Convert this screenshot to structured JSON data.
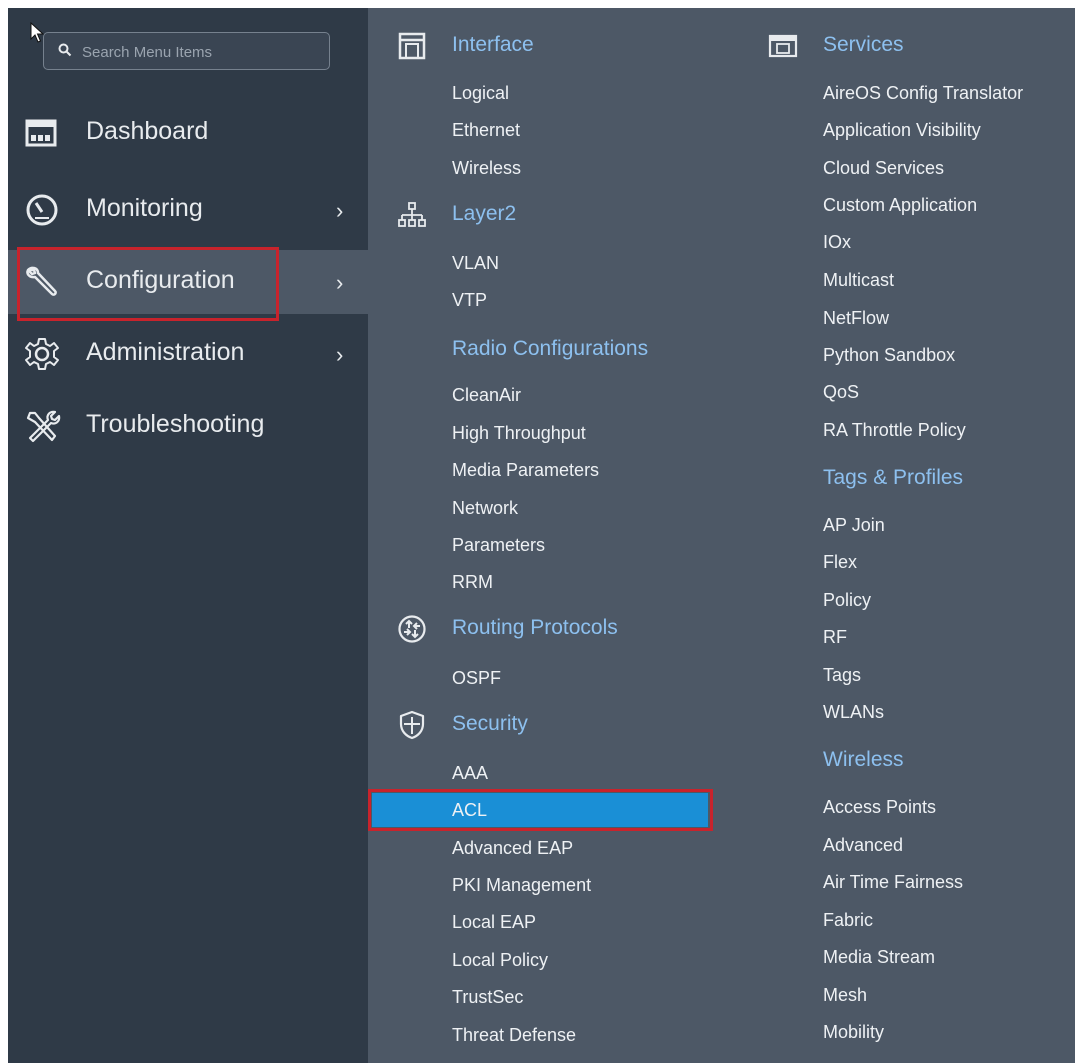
{
  "search": {
    "placeholder": "Search Menu Items"
  },
  "sidebar": {
    "items": [
      {
        "label": "Dashboard",
        "icon": "dashboard-icon"
      },
      {
        "label": "Monitoring",
        "icon": "gauge-icon",
        "chevron": "›"
      },
      {
        "label": "Configuration",
        "icon": "wrench-icon",
        "chevron": "›",
        "active": true
      },
      {
        "label": "Administration",
        "icon": "gear-icon",
        "chevron": "›"
      },
      {
        "label": "Troubleshooting",
        "icon": "tools-icon"
      }
    ]
  },
  "menu": {
    "col1": {
      "interface": {
        "title": "Interface",
        "icon": "interface-icon",
        "items": [
          "Logical",
          "Ethernet",
          "Wireless"
        ]
      },
      "layer2": {
        "title": "Layer2",
        "icon": "network-tree-icon",
        "items": [
          "VLAN",
          "VTP"
        ]
      },
      "radio": {
        "title": "Radio Configurations",
        "items": [
          "CleanAir",
          "High Throughput",
          "Media Parameters",
          "Network",
          "Parameters",
          "RRM"
        ]
      },
      "routing": {
        "title": "Routing Protocols",
        "icon": "routing-icon",
        "items": [
          "OSPF"
        ]
      },
      "security": {
        "title": "Security",
        "icon": "shield-icon",
        "items": [
          "AAA",
          "ACL",
          "Advanced EAP",
          "PKI Management",
          "Local EAP",
          "Local Policy",
          "TrustSec",
          "Threat Defense"
        ]
      }
    },
    "col2": {
      "services": {
        "title": "Services",
        "icon": "services-icon",
        "items": [
          "AireOS Config Translator",
          "Application Visibility",
          "Cloud Services",
          "Custom Application",
          "IOx",
          "Multicast",
          "NetFlow",
          "Python Sandbox",
          "QoS",
          "RA Throttle Policy"
        ]
      },
      "tags": {
        "title": "Tags & Profiles",
        "items": [
          "AP Join",
          "Flex",
          "Policy",
          "RF",
          "Tags",
          "WLANs"
        ]
      },
      "wireless": {
        "title": "Wireless",
        "items": [
          "Access Points",
          "Advanced",
          "Air Time Fairness",
          "Fabric",
          "Media Stream",
          "Mesh",
          "Mobility"
        ]
      }
    },
    "selected_item": "ACL"
  },
  "colors": {
    "sidebar_bg": "#2f3a47",
    "panel_bg": "#4d5866",
    "heading": "#8dc0ef",
    "selected_bg": "#1a8fd6",
    "highlight_box": "#c8232c"
  }
}
